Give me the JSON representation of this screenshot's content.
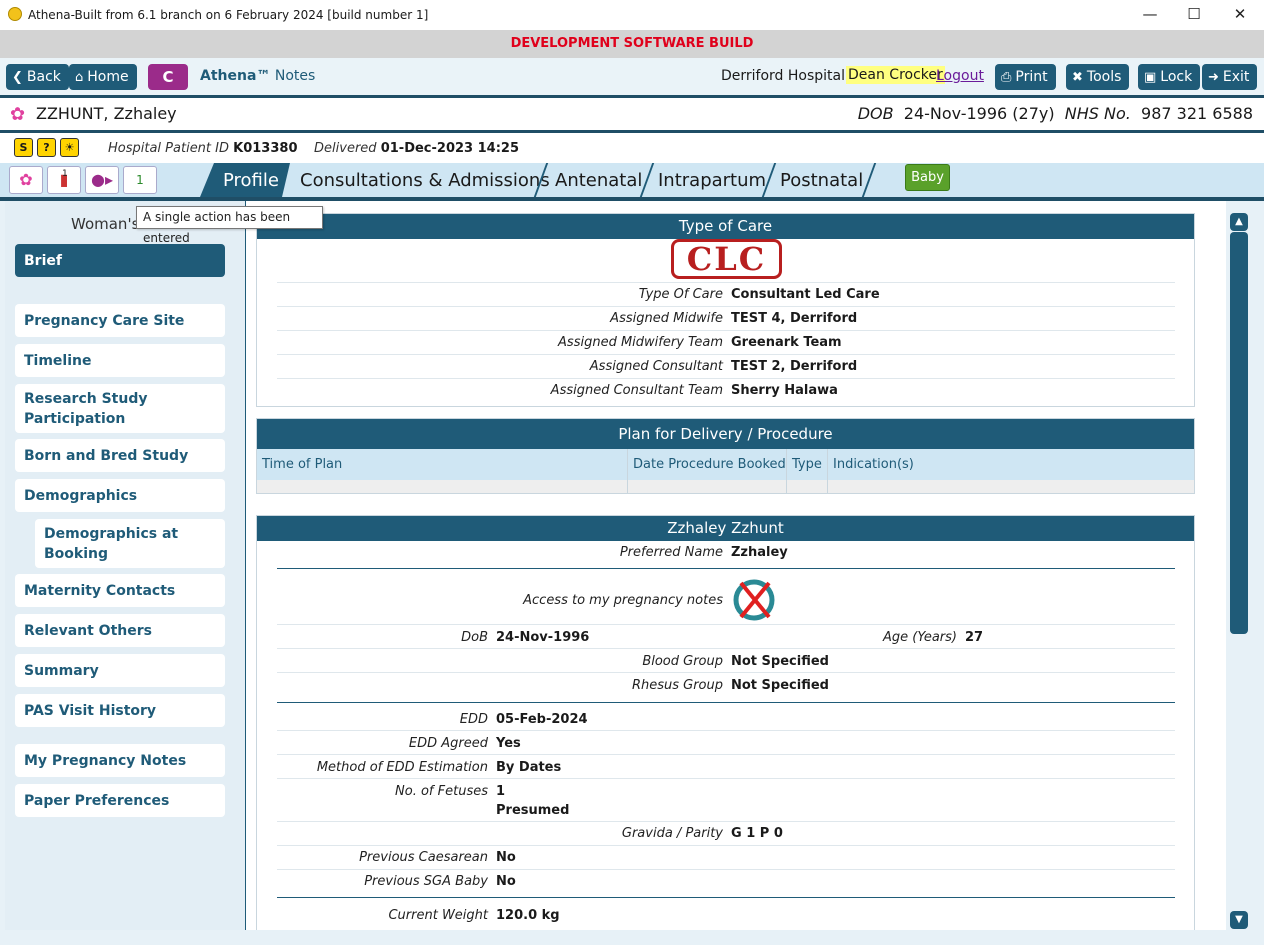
{
  "window": {
    "title": "Athena-Built from 6.1 branch on 6 February 2024 [build number 1]"
  },
  "banner": "DEVELOPMENT SOFTWARE BUILD",
  "toolbar": {
    "back": "Back",
    "home": "Home",
    "c": "C",
    "brand": "Athena™",
    "brand_sub": "Notes",
    "hospital": "Derriford Hospital",
    "user": "Dean Crocker",
    "logout": "Logout",
    "print": "Print",
    "tools": "Tools",
    "lock": "Lock",
    "exit": "Exit"
  },
  "patient": {
    "name": "ZZHUNT, Zzhaley",
    "dob_label": "DOB",
    "dob": "24-Nov-1996 (27y)",
    "nhs_label": "NHS No.",
    "nhs": "987 321 6588",
    "hospital_id_label": "Hospital Patient ID",
    "hospital_id": "K013380",
    "delivered_label": "Delivered",
    "delivered": "01-Dec-2023 14:25"
  },
  "tabs": [
    "Profile",
    "Consultations & Admissions",
    "Antenatal",
    "Intrapartum",
    "Postnatal"
  ],
  "baby": "Baby",
  "tab_icon_count": "1",
  "sidebar": {
    "heading": "Woman's",
    "tooltip": "A single action has been entered",
    "items": [
      "Brief",
      "Pregnancy Care Site",
      "Timeline",
      "Research Study Participation",
      "Born and Bred Study",
      "Demographics",
      "Demographics at Booking",
      "Maternity Contacts",
      "Relevant Others",
      "Summary",
      "PAS Visit History",
      "My Pregnancy Notes",
      "Paper Preferences"
    ]
  },
  "care": {
    "title": "Type of Care",
    "stamp": "CLC",
    "rows": [
      {
        "label": "Type Of Care",
        "value": "Consultant Led Care"
      },
      {
        "label": "Assigned Midwife",
        "value": "TEST 4, Derriford"
      },
      {
        "label": "Assigned Midwifery Team",
        "value": "Greenark Team"
      },
      {
        "label": "Assigned Consultant",
        "value": "TEST 2, Derriford"
      },
      {
        "label": "Assigned Consultant Team",
        "value": "Sherry Halawa"
      }
    ]
  },
  "plan": {
    "title": "Plan for Delivery / Procedure",
    "columns": [
      "Time of Plan",
      "Date Procedure Booked",
      "Type",
      "Indication(s)"
    ]
  },
  "woman": {
    "title": "Zzhaley Zzhunt",
    "preferred_name_label": "Preferred Name",
    "preferred_name": "Zzhaley",
    "access_label": "Access to my pregnancy notes",
    "dob_label": "DoB",
    "dob": "24-Nov-1996",
    "age_label": "Age (Years)",
    "age": "27",
    "blood_label": "Blood Group",
    "blood": "Not Specified",
    "rhesus_label": "Rhesus Group",
    "rhesus": "Not Specified",
    "edd_label": "EDD",
    "edd": "05-Feb-2024",
    "edd_agreed_label": "EDD Agreed",
    "edd_agreed": "Yes",
    "method_label": "Method of EDD Estimation",
    "method": "By Dates",
    "fetuses_label": "No. of Fetuses",
    "fetuses": "1",
    "fetuses_note": "Presumed",
    "gravida_label": "Gravida / Parity",
    "gravida": "G 1 P 0",
    "caesarean_label": "Previous Caesarean",
    "caesarean": "No",
    "sga_label": "Previous SGA Baby",
    "sga": "No",
    "weight_label": "Current Weight",
    "weight": "120.0 kg"
  }
}
